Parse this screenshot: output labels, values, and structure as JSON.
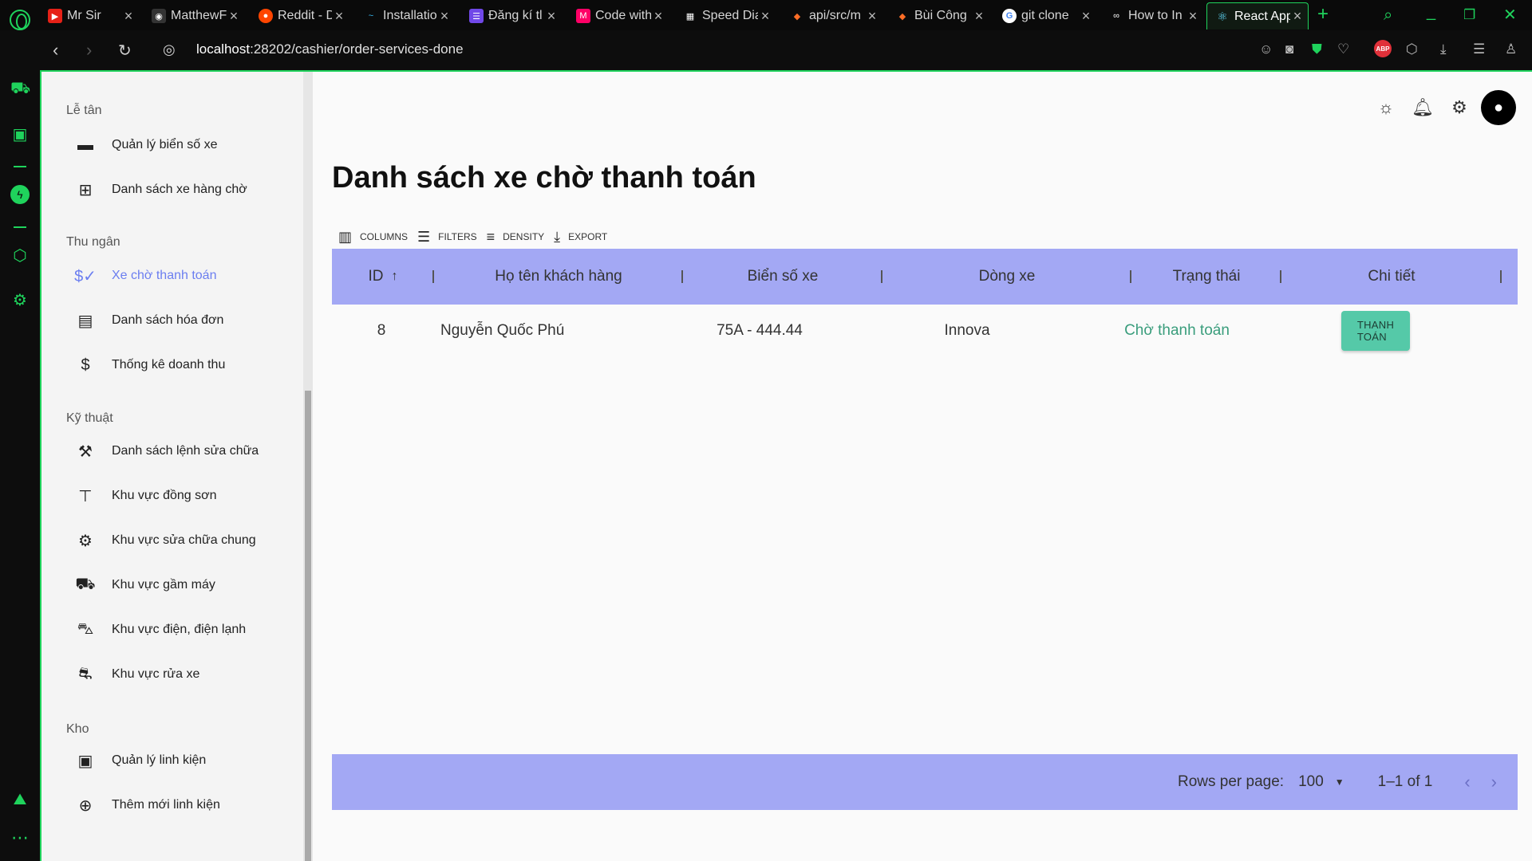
{
  "browser": {
    "tabs": [
      {
        "label": "Mr Sir",
        "fav_color": "#e62117",
        "fav": "▶"
      },
      {
        "label": "MatthewF",
        "fav_color": "#333333",
        "fav": "◉"
      },
      {
        "label": "Reddit - D",
        "fav_color": "#ff4500",
        "fav": "●"
      },
      {
        "label": "Installatio",
        "fav_color": "#38bdf8",
        "fav": "~"
      },
      {
        "label": "Đăng kí tl",
        "fav_color": "#7048e8",
        "fav": "☰"
      },
      {
        "label": "Code with",
        "fav_color": "#ff0066",
        "fav": "M"
      },
      {
        "label": "Speed Dia",
        "fav_color": "#444444",
        "fav": "▦"
      },
      {
        "label": "api/src/m",
        "fav_color": "#fc6d26",
        "fav": "◆"
      },
      {
        "label": "Bùi Công",
        "fav_color": "#fc6d26",
        "fav": "◆"
      },
      {
        "label": "git clone",
        "fav_color": "#4285f4",
        "fav": "G"
      },
      {
        "label": "How to In",
        "fav_color": "#555555",
        "fav": "∞"
      },
      {
        "label": "React App",
        "fav_color": "#61dafb",
        "fav": "⚛"
      }
    ],
    "url_host": "localhost",
    "url_rest": ":28202/cashier/order-services-done"
  },
  "menu": {
    "sections": [
      {
        "title": "Lễ tân",
        "items": [
          "Quản lý biển số xe",
          "Danh sách xe hàng chờ"
        ]
      },
      {
        "title": "Thu ngân",
        "items": [
          "Xe chờ thanh toán",
          "Danh sách hóa đơn",
          "Thống kê doanh thu"
        ]
      },
      {
        "title": "Kỹ thuật",
        "items": [
          "Danh sách lệnh sửa chữa",
          "Khu vực đồng sơn",
          "Khu vực sửa chữa chung",
          "Khu vực gầm máy",
          "Khu vực điện, điện lạnh",
          "Khu vực rửa xe"
        ]
      },
      {
        "title": "Kho",
        "items": [
          "Quản lý linh kiện",
          "Thêm mới linh kiện"
        ]
      }
    ],
    "active_item": "Xe chờ thanh toán"
  },
  "page": {
    "title": "Danh sách xe chờ thanh toán"
  },
  "toolbar": {
    "columns": "COLUMNS",
    "filters": "FILTERS",
    "density": "DENSITY",
    "export": "EXPORT"
  },
  "table": {
    "columns": [
      "ID",
      "Họ tên khách hàng",
      "Biển số xe",
      "Dòng xe",
      "Trạng thái",
      "Chi tiết"
    ],
    "rows": [
      {
        "id": "8",
        "name": "Nguyễn Quốc Phú",
        "plate": "75A - 444.44",
        "model": "Innova",
        "status": "Chờ thanh toán",
        "action": "THANH TOÁN"
      }
    ],
    "status_color": "#3a9d7c",
    "header_color": "#a3a8f4"
  },
  "pagination": {
    "rows_per_page_label": "Rows per page:",
    "rows_per_page": "100",
    "range": "1–1 of 1"
  }
}
